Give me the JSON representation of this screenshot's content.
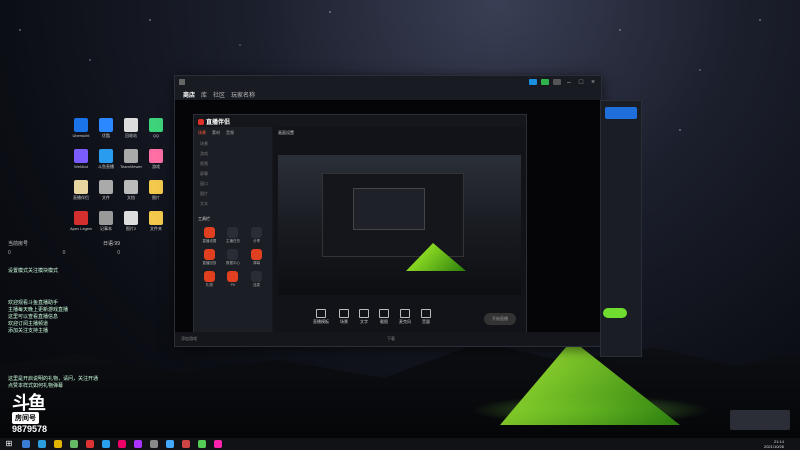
{
  "desktop": {
    "icons": [
      {
        "label": "Ubersicht",
        "color": "#1a73e8"
      },
      {
        "label": "优酷",
        "color": "#2b88ff"
      },
      {
        "label": "回收站",
        "color": "#ddd"
      },
      {
        "label": "QQ",
        "color": "#3dd37a"
      },
      {
        "label": "WeMod",
        "color": "#7a5cff"
      },
      {
        "label": "斗鱼直播",
        "color": "#2a9cf0"
      },
      {
        "label": "TeamViewer",
        "color": "#aaa"
      },
      {
        "label": "游戏",
        "color": "#ff6fa3"
      },
      {
        "label": "直播伴侣",
        "color": "#e8d6a0"
      },
      {
        "label": "文件",
        "color": "#aaa"
      },
      {
        "label": "文档",
        "color": "#bbb"
      },
      {
        "label": "图片",
        "color": "#f2c94c"
      },
      {
        "label": "Apex Legends",
        "color": "#d32f2f"
      },
      {
        "label": "记事本",
        "color": "#999"
      },
      {
        "label": "图片2",
        "color": "#ddd"
      },
      {
        "label": "文件夹",
        "color": "#f2c94c"
      }
    ]
  },
  "overlay": {
    "streamer_left": "当前房号",
    "streamer_right": "日语:99",
    "nums": [
      "0",
      "0",
      "0"
    ],
    "notice_title": "设置模式关注模块模式",
    "notice_lines": [
      "欢迎观看斗鱼直播助手",
      "主播每天晚上更新游戏直播",
      "这里可以查看直播信息",
      "欢迎订阅主播频道",
      "添加关注支持主播"
    ],
    "bottom_lines": [
      "这里是开启说明的礼物，请问，关注开通",
      "点赞本样式如何礼物弹幕"
    ]
  },
  "douyu": {
    "logo": "斗鱼",
    "room_label": "房间号",
    "room_no": "9879578"
  },
  "window": {
    "nav": [
      "商店",
      "库",
      "社区",
      "玩家名称"
    ],
    "active_nav": "商店",
    "footer_left": "添加游戏",
    "footer_center": "下载",
    "close": "×",
    "minimize": "–",
    "maximize": "□"
  },
  "app": {
    "brand": "直播伴侣",
    "tabs": [
      "场景",
      "素材",
      "音频"
    ],
    "active_tab": "场景",
    "sources": [
      "场景",
      "游戏",
      "视频",
      "屏幕",
      "窗口",
      "图片",
      "文本"
    ],
    "tools_title": "工具栏",
    "tools": [
      {
        "label": "直播设置",
        "red": true
      },
      {
        "label": "主播任务",
        "red": false
      },
      {
        "label": "分享",
        "red": false
      },
      {
        "label": "直播回放",
        "red": true
      },
      {
        "label": "数据中心",
        "red": false
      },
      {
        "label": "弹幕",
        "red": true
      },
      {
        "label": "礼物",
        "red": true
      },
      {
        "label": "PK",
        "red": true
      },
      {
        "label": "连麦",
        "red": false
      }
    ],
    "toolbar_text": "画面设置",
    "bottom_tools": [
      "直播模板",
      "场景",
      "文字",
      "截图",
      "麦克风",
      "音量"
    ],
    "start_live": "开始直播"
  },
  "taskbar": {
    "time": "21:14",
    "date": "2021/10/26",
    "start_icon": "windows-logo-icon"
  }
}
